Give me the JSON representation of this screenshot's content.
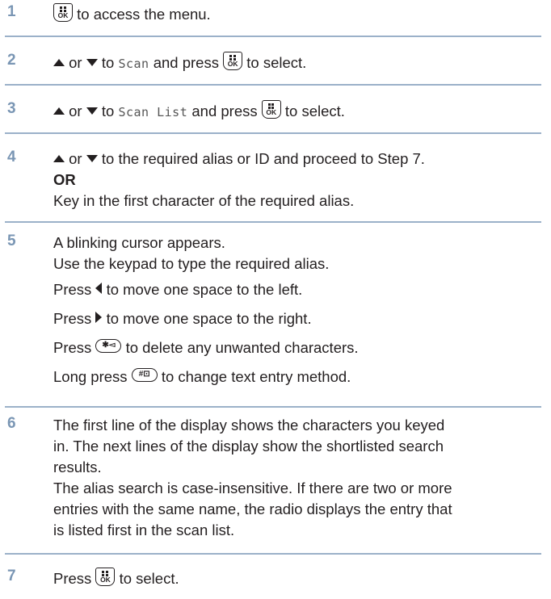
{
  "steps": [
    {
      "num": "1",
      "text_a": "to access the menu."
    },
    {
      "num": "2",
      "text_or": "or",
      "text_to": "to",
      "menu_item": "Scan",
      "text_b": "and press",
      "text_c": "to select."
    },
    {
      "num": "3",
      "text_or": "or",
      "text_to": "to",
      "menu_item": "Scan List",
      "text_b": "and press",
      "text_c": "to select."
    },
    {
      "num": "4",
      "text_or": "or",
      "text_a": "to the required alias or ID and proceed to Step 7.",
      "or_label": "OR",
      "text_b": "Key in the first character of the required alias."
    },
    {
      "num": "5",
      "line1": "A blinking cursor appears.",
      "line2": "Use the keypad to type the required alias.",
      "press": "Press",
      "left_text": "to move one space to the left.",
      "right_text": "to move one space to the right.",
      "delete_text": "to delete any unwanted characters.",
      "long_press": "Long press",
      "entry_text": "to change text entry method."
    },
    {
      "num": "6",
      "lines": [
        "The first line of the display shows the characters you keyed",
        "in. The next lines of the display show the shortlisted search",
        "results.",
        "The alias search is case-insensitive. If there are two or more",
        "entries with the same name, the radio displays the entry that",
        "is listed first in the scan list."
      ]
    },
    {
      "num": "7",
      "text_a": "Press",
      "text_b": "to select."
    }
  ],
  "keys": {
    "ok": "OK",
    "star": "✱◅",
    "hash": "#⊡"
  },
  "icons": {
    "ok": "menu-ok-key-icon",
    "up": "up-arrow-icon",
    "down": "down-arrow-icon",
    "left": "left-arrow-icon",
    "right": "right-arrow-icon",
    "star": "star-delete-key-icon",
    "hash": "hash-key-icon"
  },
  "colors": {
    "step_number": "#7a96b4",
    "divider": "#9bb1c9",
    "text": "#231f20"
  }
}
